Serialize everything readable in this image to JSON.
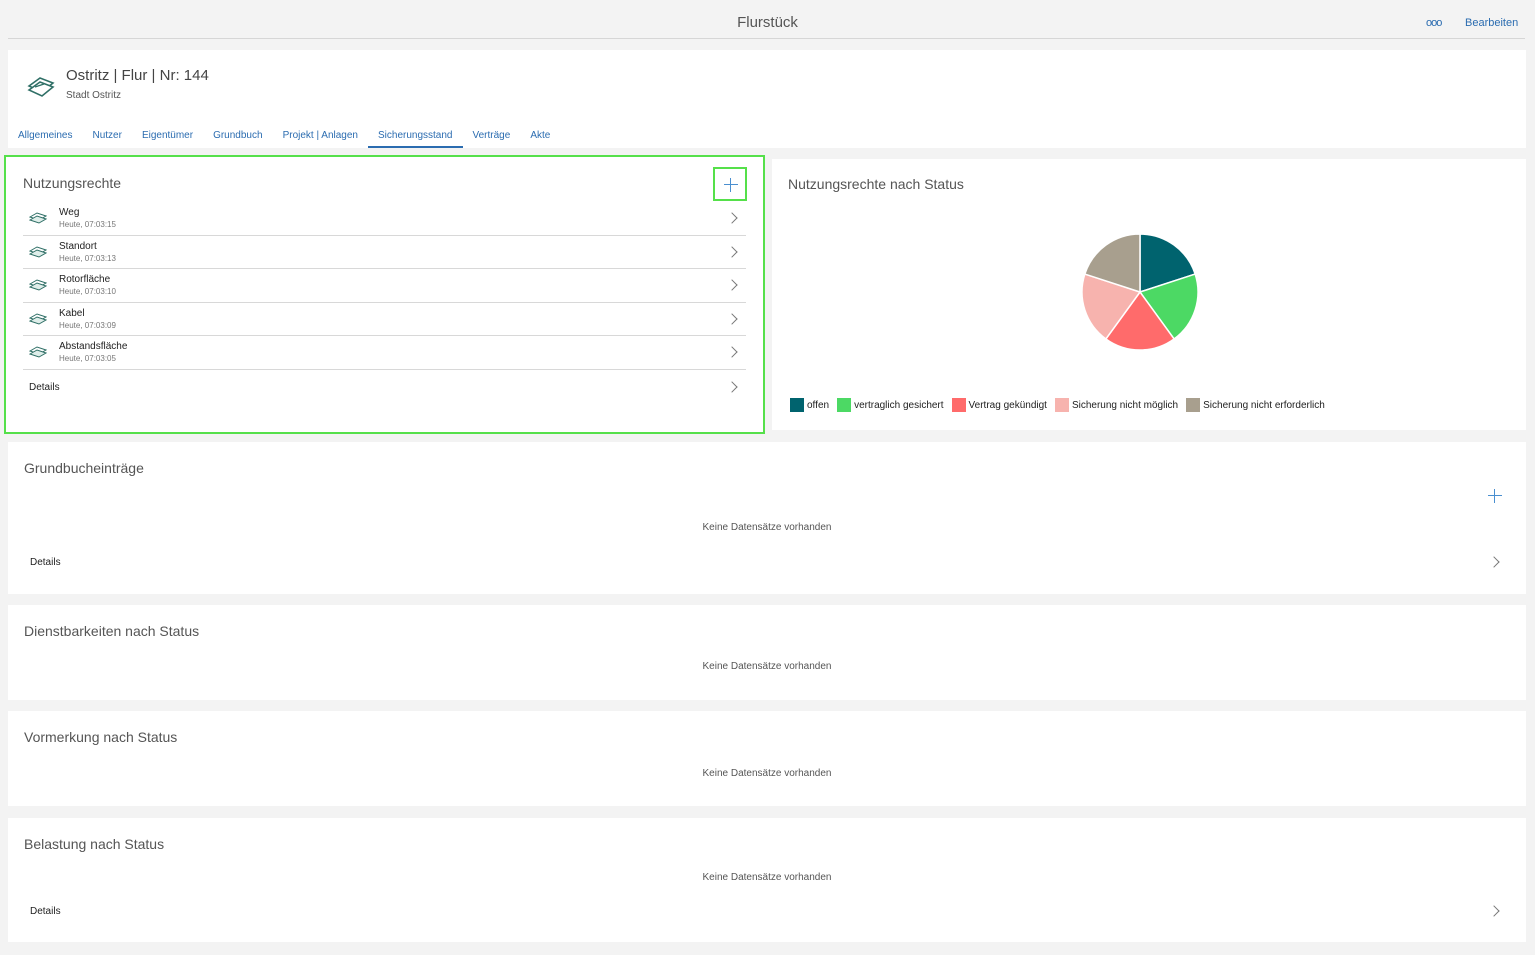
{
  "topbar": {
    "title": "Flurstück",
    "more_label": "ooo",
    "edit_label": "Bearbeiten"
  },
  "header": {
    "title": "Ostritz | Flur | Nr: 144",
    "subtitle": "Stadt Ostritz",
    "icon": "parcel-icon",
    "tabs": [
      {
        "label": "Allgemeines"
      },
      {
        "label": "Nutzer"
      },
      {
        "label": "Eigentümer"
      },
      {
        "label": "Grundbuch"
      },
      {
        "label": "Projekt | Anlagen"
      },
      {
        "label": "Sicherungsstand",
        "active": true
      },
      {
        "label": "Verträge"
      },
      {
        "label": "Akte"
      }
    ]
  },
  "nutzungsrechte": {
    "title": "Nutzungsrechte",
    "items": [
      {
        "name": "Weg",
        "time": "Heute, 07:03:15"
      },
      {
        "name": "Standort",
        "time": "Heute, 07:03:13"
      },
      {
        "name": "Rotorfläche",
        "time": "Heute, 07:03:10"
      },
      {
        "name": "Kabel",
        "time": "Heute, 07:03:09"
      },
      {
        "name": "Abstandsfläche",
        "time": "Heute, 07:03:05"
      }
    ],
    "details_label": "Details"
  },
  "chart": {
    "title": "Nutzungsrechte nach Status"
  },
  "chart_data": {
    "type": "pie",
    "title": "Nutzungsrechte nach Status",
    "legend_position": "bottom-left",
    "labels": [
      "offen",
      "vertraglich gesichert",
      "Vertrag gekündigt",
      "Sicherung nicht möglich",
      "Sicherung nicht erforderlich"
    ],
    "values": [
      1,
      1,
      1,
      1,
      1
    ],
    "colors": [
      "#00636e",
      "#4cd964",
      "#ff6b6b",
      "#f7b3ae",
      "#a89f8e"
    ]
  },
  "grundbuch": {
    "title": "Grundbucheinträge",
    "empty": "Keine Datensätze vorhanden",
    "details_label": "Details"
  },
  "dienstbarkeiten": {
    "title": "Dienstbarkeiten nach Status",
    "empty": "Keine Datensätze vorhanden"
  },
  "vormerkung": {
    "title": "Vormerkung nach Status",
    "empty": "Keine Datensätze vorhanden"
  },
  "belastung": {
    "title": "Belastung nach Status",
    "empty": "Keine Datensätze vorhanden",
    "details_label": "Details"
  }
}
